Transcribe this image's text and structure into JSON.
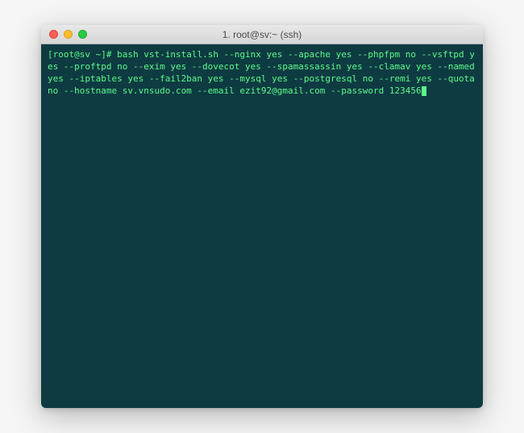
{
  "window": {
    "title": "1. root@sv:~ (ssh)"
  },
  "terminal": {
    "prompt": "[root@sv ~]#",
    "command": "bash vst-install.sh --nginx yes --apache yes --phpfpm no --vsftpd yes --proftpd no --exim yes --dovecot yes --spamassassin yes --clamav yes --named yes --iptables yes --fail2ban yes --mysql yes --postgresql no --remi yes --quota no --hostname sv.vnsudo.com --email ezit92@gmail.com --password 123456"
  }
}
